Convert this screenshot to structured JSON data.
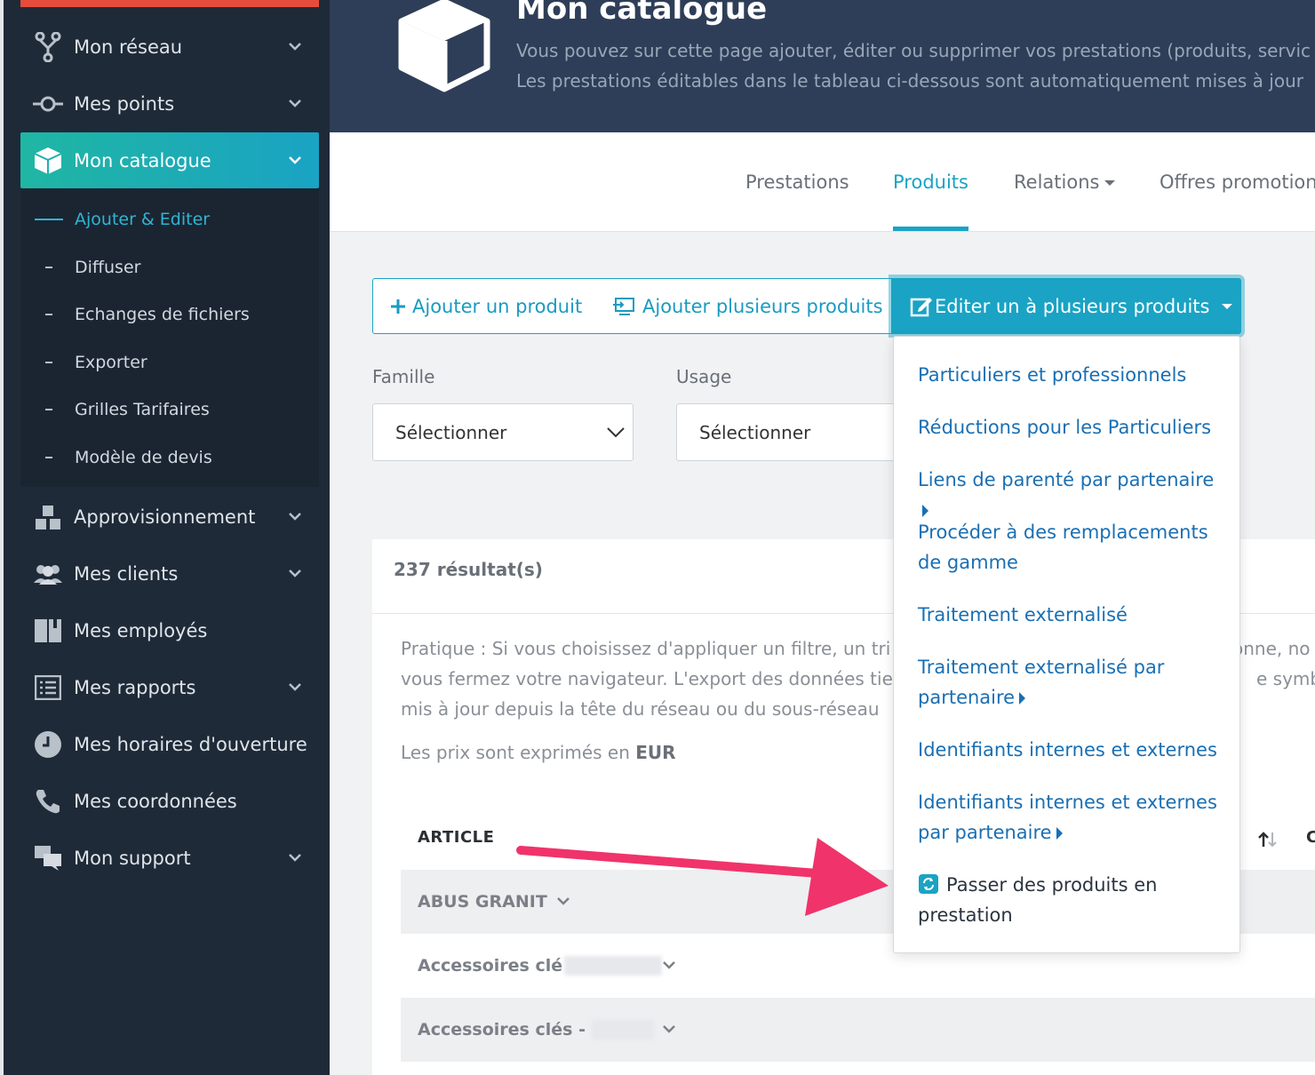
{
  "sidebar": {
    "items": [
      {
        "label": "Mon réseau",
        "icon": "network-icon"
      },
      {
        "label": "Mes points",
        "icon": "points-icon"
      },
      {
        "label": "Mon catalogue",
        "icon": "cube-icon"
      },
      {
        "label": "Approvisionnement",
        "icon": "boxes-icon"
      },
      {
        "label": "Mes clients",
        "icon": "users-icon"
      },
      {
        "label": "Mes employés",
        "icon": "book-icon"
      },
      {
        "label": "Mes rapports",
        "icon": "list-icon"
      },
      {
        "label": "Mes horaires d'ouverture",
        "icon": "clock-icon"
      },
      {
        "label": "Mes coordonnées",
        "icon": "phone-icon"
      },
      {
        "label": "Mon support",
        "icon": "chat-icon"
      }
    ],
    "submenu": [
      "Ajouter & Editer",
      "Diffuser",
      "Echanges de fichiers",
      "Exporter",
      "Grilles Tarifaires",
      "Modèle de devis"
    ]
  },
  "header": {
    "title": "Mon catalogue",
    "desc1": "Vous pouvez sur cette page ajouter, éditer ou supprimer vos prestations (produits, servic",
    "desc2": "Les prestations éditables dans le tableau ci-dessous sont automatiquement mises à jour"
  },
  "tabs": [
    "Prestations",
    "Produits",
    "Relations",
    "Offres promotion"
  ],
  "buttons": {
    "add_one": "Ajouter un produit",
    "add_many": "Ajouter plusieurs produits",
    "edit": "Editer un à plusieurs produits"
  },
  "filters": {
    "famille_label": "Famille",
    "usage_label": "Usage",
    "select_value": "Sélectionner"
  },
  "results": {
    "count": "237 résultat(s)",
    "para1": "Pratique : Si vous choisissez d'appliquer un filtre, un tri",
    "para1_end": "onne, no",
    "para2": "vous fermez votre navigateur. L'export des données tie",
    "para2_end": "e symbo",
    "para3": "mis à jour depuis la tête du réseau ou du sous-réseau",
    "price_prefix": "Les prix sont exprimés en",
    "currency": "EUR",
    "col_article": "ARTICLE",
    "col_c": "C",
    "rows": [
      "ABUS GRANIT",
      "Accessoires clé",
      "Accessoires clés - "
    ]
  },
  "dropdown": {
    "items": [
      "Particuliers et professionnels",
      "Réductions pour les Particuliers",
      "Liens de parenté par partenaire",
      "Procéder à des remplacements",
      "de gamme",
      "Traitement externalisé",
      "Traitement externalisé par",
      "partenaire",
      "Identifiants internes et externes",
      "Identifiants internes et externes",
      "par partenaire",
      "Passer des produits en",
      "prestation"
    ]
  },
  "colors": {
    "sidebar_bg": "#1f2a38",
    "header_bg": "#2e3e58",
    "accent": "#1aa3c4",
    "link": "#1a6fb3",
    "arrow": "#f0336a"
  }
}
